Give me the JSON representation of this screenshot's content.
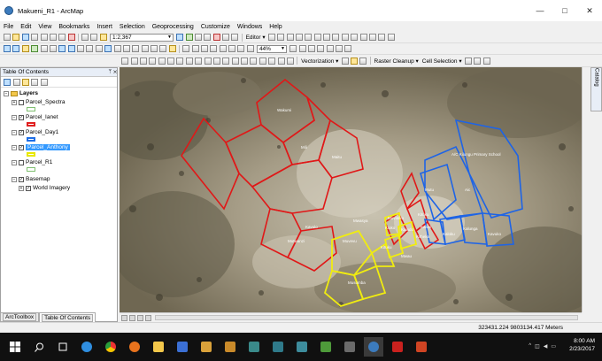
{
  "window": {
    "title": "Makueni_R1 - ArcMap",
    "buttons": {
      "minimize": "—",
      "maximize": "□",
      "close": "✕"
    }
  },
  "menu": [
    "File",
    "Edit",
    "View",
    "Bookmarks",
    "Insert",
    "Selection",
    "Geoprocessing",
    "Customize",
    "Windows",
    "Help"
  ],
  "toolbars": {
    "scale": "1:2,367",
    "editor_label": "Editor ▾",
    "zoom_percent": "44%",
    "vectorization_label": "Vectorization ▾",
    "raster_cleanup_label": "Raster Cleanup ▾",
    "cell_selection_label": "Cell Selection ▾"
  },
  "toc": {
    "title": "Table Of Contents",
    "pin": "ᛘ ✕",
    "root": "Layers",
    "layers": [
      {
        "name": "Parcel_Spectra",
        "checked": false,
        "swatch_color": "#c8f0c0"
      },
      {
        "name": "Parcel_Ianet",
        "checked": true,
        "swatch_color": "#e02020"
      },
      {
        "name": "Parcel_Day1",
        "checked": true,
        "swatch_color": "#1e6ee6"
      },
      {
        "name": "Parcel_Anthony",
        "checked": true,
        "swatch_color": "#f0f000"
      },
      {
        "name": "Parcel_R1",
        "checked": false,
        "swatch_color": "#c8f0c0"
      }
    ],
    "basemap": {
      "name": "Basemap",
      "child": "World Imagery"
    }
  },
  "bottom_tabs": {
    "arctoolbox": "ArcToolbox",
    "toc": "Table Of Contents"
  },
  "catalog_label": "Catalog",
  "map": {
    "labels": {
      "red": [
        "Wakumi",
        "Mili",
        "Maitu",
        "Kavulo",
        "Mutwanzi",
        "Muvatiko",
        "Kituku",
        "Kaluvi",
        "Kitheka",
        "Mwau"
      ],
      "blue": [
        "A/C Kilungu Primary School",
        "Aic",
        "Nzawi",
        "Kavuko",
        "Kalunga",
        "Kaloku"
      ],
      "yellow": [
        "Muvevu",
        "Musomba",
        "Kituku",
        "Kioko",
        "Kaindo",
        "Munyao",
        "Mwela"
      ],
      "center": [
        "Mutu",
        "Mwasya"
      ]
    }
  },
  "status": {
    "coordinates": "323431.224  9803134.417 Meters"
  },
  "taskbar": {
    "time": "8:00 AM",
    "date": "2/23/2017"
  }
}
